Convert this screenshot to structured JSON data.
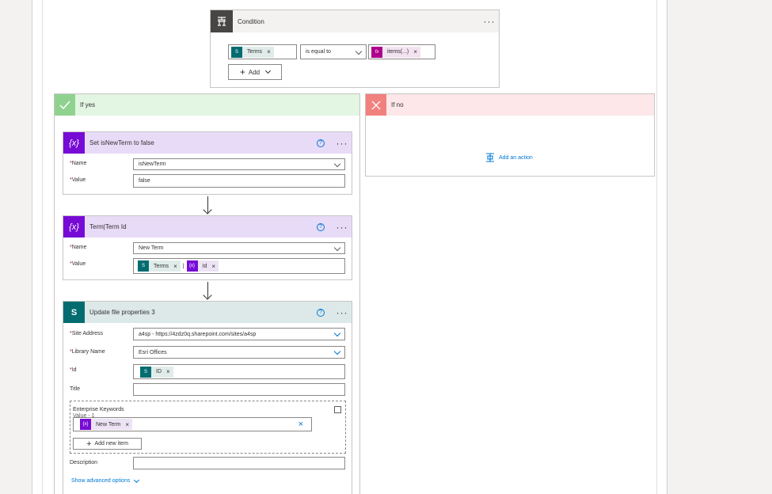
{
  "condition": {
    "title": "Condition",
    "left_token": "Terms",
    "operator": "is equal to",
    "right_token": "items(...)",
    "add_label": "Add"
  },
  "if_yes": {
    "title": "If yes"
  },
  "if_no": {
    "title": "If no",
    "add_action_label": "Add an action"
  },
  "set_var": {
    "title": "Set isNewTerm to false",
    "name_label": "Name",
    "name_value": "isNewTerm",
    "value_label": "Value",
    "value_value": "false"
  },
  "term_var": {
    "title": "Term|Term Id",
    "name_label": "Name",
    "name_value": "New Term",
    "value_label": "Value",
    "token1": "Terms",
    "token2": "Id"
  },
  "update_file": {
    "title": "Update file properties 3",
    "site_label": "Site Address",
    "site_value": "a4sp - https://4zdz0q.sharepoint.com/sites/a4sp",
    "library_label": "Library Name",
    "library_value": "Esri Offices",
    "id_label": "Id",
    "id_token": "ID",
    "title_label": "Title",
    "keywords_label": "Enterprise Keywords",
    "keywords_sub": "Value - 1",
    "keywords_token": "New Term",
    "add_item_label": "Add new item",
    "description_label": "Description",
    "advanced_label": "Show advanced options"
  },
  "colors": {
    "condition_header": "#f3f2f1",
    "condition_icon": "#484644",
    "yes_header": "#e3f5e3",
    "yes_icon": "#8fd28f",
    "no_header": "#fde7e9",
    "no_icon": "#f1817d",
    "variable_header": "#e8dbf7",
    "variable_icon": "#770bd6",
    "sharepoint_header": "#dde9e9",
    "sharepoint_icon": "#036c70"
  }
}
